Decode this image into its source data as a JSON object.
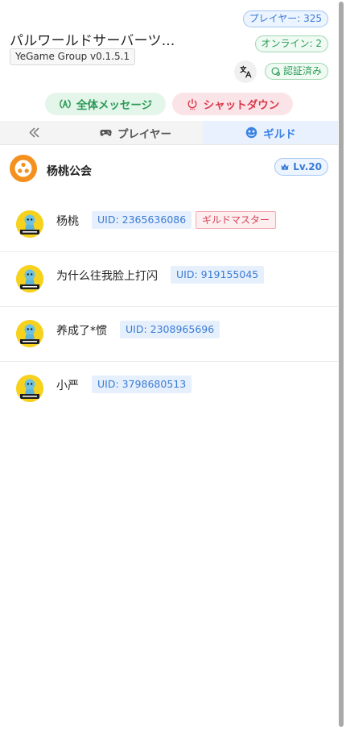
{
  "header": {
    "title": "パルワールドサーバーツ...",
    "version": "YeGame Group v0.1.5.1",
    "players_badge": "プレイヤー: 325",
    "online_badge": "オンライン: 2",
    "verified_badge": "認証済み"
  },
  "actions": {
    "broadcast_label": "全体メッセージ",
    "shutdown_label": "シャットダウン"
  },
  "tabs": {
    "players_label": "プレイヤー",
    "guild_label": "ギルド",
    "active": "guild"
  },
  "guild": {
    "name": "杨桃公会",
    "level": "Lv.20"
  },
  "members": [
    {
      "name": "杨桃",
      "uid": "UID: 2365636086",
      "role": "ギルドマスター"
    },
    {
      "name": "为什么往我脸上打闪",
      "uid": "UID: 919155045"
    },
    {
      "name": "养成了*惯",
      "uid": "UID: 2308965696"
    },
    {
      "name": "小严",
      "uid": "UID: 3798680513"
    }
  ],
  "colors": {
    "accent_blue": "#3a82e4",
    "success_green": "#2b9a57",
    "danger_red": "#d93a4c",
    "guild_orange": "#f5901e"
  },
  "icons": {
    "broadcast": "broadcast-icon",
    "shutdown": "power-icon",
    "collapse": "double-chevron-left-icon",
    "players_tab": "gamepad-icon",
    "guild_tab": "guild-icon",
    "translate": "translate-icon",
    "verified": "verified-icon",
    "level": "crown-icon"
  }
}
